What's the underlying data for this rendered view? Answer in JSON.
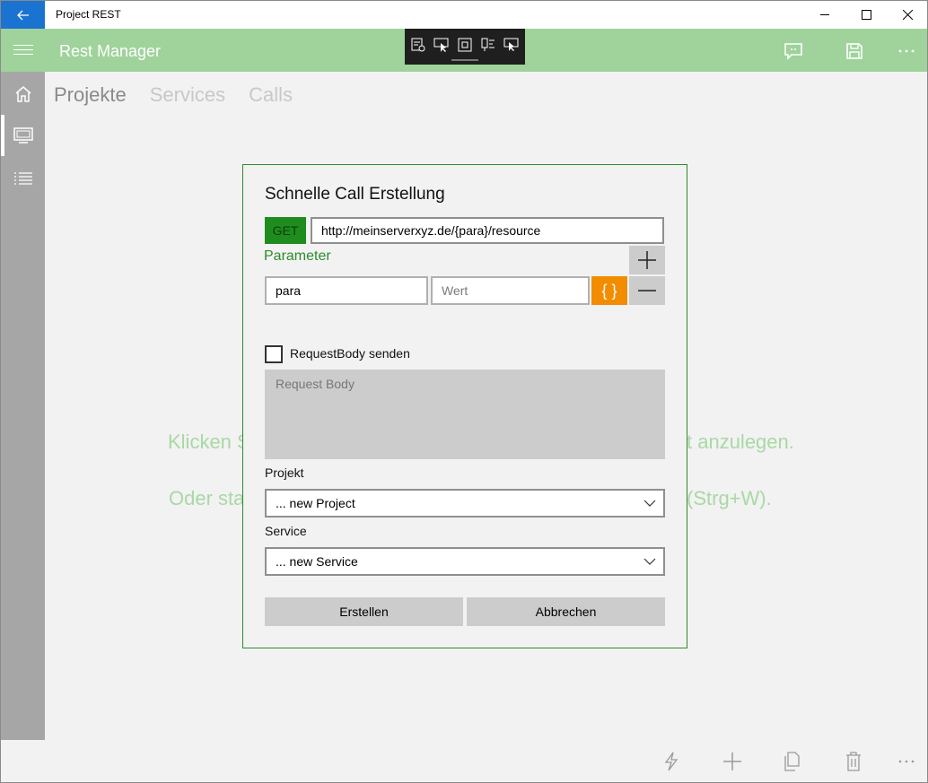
{
  "window": {
    "title": "Project REST"
  },
  "header": {
    "title": "Rest Manager"
  },
  "tabs": [
    {
      "label": "Projekte"
    },
    {
      "label": "Services"
    },
    {
      "label": "Calls"
    }
  ],
  "hint": {
    "line1_left": "Klicken S",
    "line1_right": "t anzulegen.",
    "line2_left": "Oder sta",
    "line2_right": "(Strg+W)."
  },
  "dialog": {
    "title": "Schnelle Call Erstellung",
    "method": "GET",
    "url": "http://meinserverxyz.de/{para}/resource",
    "parameter_label": "Parameter",
    "param_name": "para",
    "param_value_placeholder": "Wert",
    "brace_label": "{ }",
    "request_body_checkbox_label": "RequestBody senden",
    "request_body_checked": false,
    "request_body_placeholder": "Request Body",
    "project_label": "Projekt",
    "project_selected": "... new Project",
    "service_label": "Service",
    "service_selected": "... new Service",
    "create_label": "Erstellen",
    "cancel_label": "Abbrechen"
  },
  "colors": {
    "accent": "#9fd39b",
    "back_button": "#1a73d0",
    "method_badge": "#1f8c1f",
    "brace_button": "#f28c00",
    "rail": "#a6a6a6",
    "dialog_border": "#2e8b2e"
  },
  "icons": {
    "titlebar": [
      "back-arrow-icon",
      "minimize-icon",
      "maximize-icon",
      "close-icon"
    ],
    "appbar": [
      "hamburger-icon",
      "feedback-icon",
      "save-icon",
      "more-icon"
    ],
    "rail": [
      "home-icon",
      "monitor-icon",
      "list-icon"
    ],
    "bottombar": [
      "lightning-icon",
      "add-icon",
      "copy-icon",
      "delete-icon",
      "more-icon"
    ]
  }
}
